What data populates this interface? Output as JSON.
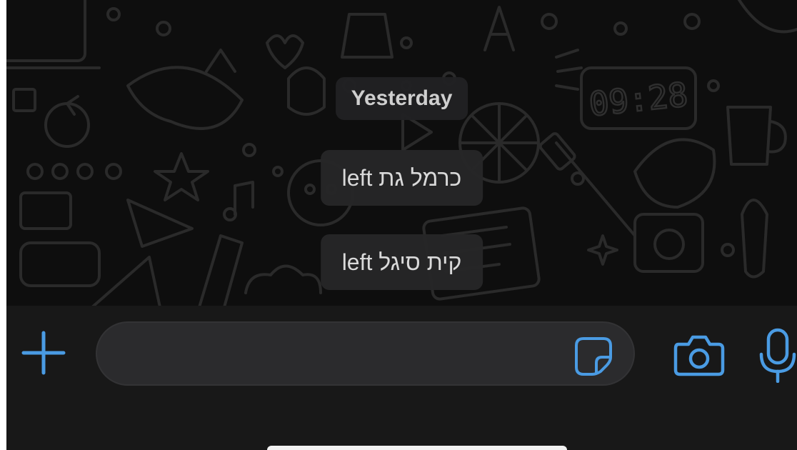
{
  "chat": {
    "date_separator": "Yesterday",
    "system_messages": [
      "left כרמל גת",
      "left קית סיגל"
    ]
  },
  "wallpaper": {
    "clock_text": "09:28"
  },
  "input_bar": {
    "add_icon": "plus-icon",
    "sticker_icon": "sticker-icon",
    "camera_icon": "camera-icon",
    "mic_icon": "microphone-icon"
  },
  "colors": {
    "accent": "#4a9be3",
    "chat_background": "#0e0e0e",
    "input_bar_background": "#181818",
    "message_field": "#2b2b2d",
    "system_bubble": "#262628",
    "system_text": "#d9d9d9"
  }
}
